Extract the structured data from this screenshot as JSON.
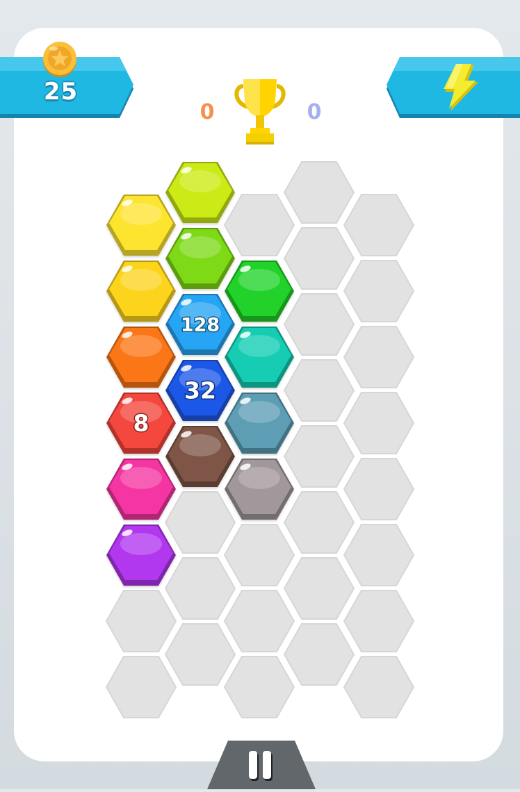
{
  "header": {
    "coins": "25",
    "score_left": "0",
    "score_right": "0"
  },
  "icons": {
    "coin": "coin-icon",
    "power": "lightning-bolt-icon",
    "trophy": "trophy-icon",
    "pause": "pause-icon"
  },
  "colors": {
    "banner": "#1fb8e3",
    "empty_cell": "#e2e2e2"
  },
  "board": {
    "columns": [
      [
        {
          "color": "#fde42f",
          "label": ""
        },
        {
          "color": "#fcd41e",
          "label": ""
        },
        {
          "color": "#fb7616",
          "label": ""
        },
        {
          "color": "#f4473c",
          "label": "8"
        },
        {
          "color": "#f534a2",
          "label": ""
        },
        {
          "color": "#b237f0",
          "label": ""
        },
        {
          "color": "",
          "label": ""
        },
        {
          "color": "",
          "label": ""
        }
      ],
      [
        {
          "color": "#ccea12",
          "label": ""
        },
        {
          "color": "#7ed918",
          "label": ""
        },
        {
          "color": "#27a5f4",
          "label": "128"
        },
        {
          "color": "#1f58e8",
          "label": "32"
        },
        {
          "color": "#7e5446",
          "label": ""
        },
        {
          "color": "",
          "label": ""
        },
        {
          "color": "",
          "label": ""
        },
        {
          "color": "",
          "label": ""
        }
      ],
      [
        {
          "color": "",
          "label": ""
        },
        {
          "color": "#21d22a",
          "label": ""
        },
        {
          "color": "#12cdb3",
          "label": ""
        },
        {
          "color": "#5d9eb4",
          "label": ""
        },
        {
          "color": "#a0989a",
          "label": ""
        },
        {
          "color": "",
          "label": ""
        },
        {
          "color": "",
          "label": ""
        },
        {
          "color": "",
          "label": ""
        }
      ],
      [
        {
          "color": "",
          "label": ""
        },
        {
          "color": "",
          "label": ""
        },
        {
          "color": "",
          "label": ""
        },
        {
          "color": "",
          "label": ""
        },
        {
          "color": "",
          "label": ""
        },
        {
          "color": "",
          "label": ""
        },
        {
          "color": "",
          "label": ""
        },
        {
          "color": "",
          "label": ""
        }
      ],
      [
        {
          "color": "",
          "label": ""
        },
        {
          "color": "",
          "label": ""
        },
        {
          "color": "",
          "label": ""
        },
        {
          "color": "",
          "label": ""
        },
        {
          "color": "",
          "label": ""
        },
        {
          "color": "",
          "label": ""
        },
        {
          "color": "",
          "label": ""
        },
        {
          "color": "",
          "label": ""
        }
      ]
    ]
  }
}
